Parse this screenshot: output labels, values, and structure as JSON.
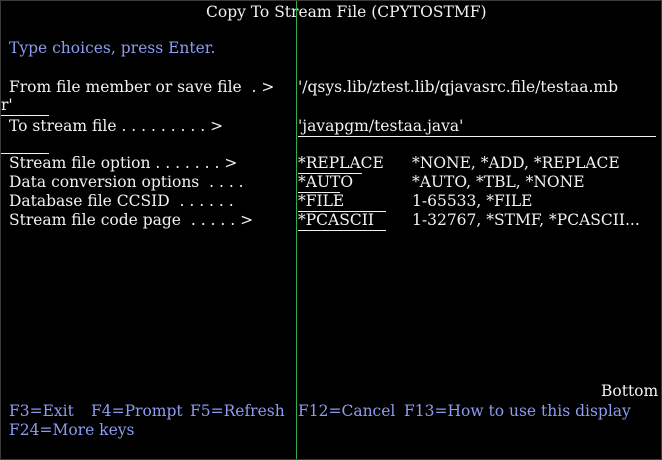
{
  "title": "Copy To Stream File (CPYTOSTMF)",
  "instruction": "Type choices, press Enter.",
  "fields": [
    {
      "label": "From file member or save file  . >",
      "value": "'/qsys.lib/ztest.lib/qjavasrc.file/testaa.mb",
      "value_wrap": "r'",
      "allowed": ""
    },
    {
      "label": "To stream file . . . . . . . . . >",
      "value": "'javapgm/testaa.java'",
      "allowed": ""
    },
    {
      "label": "Stream file option . . . . . . . >",
      "value": "*REPLACE",
      "allowed": "*NONE, *ADD, *REPLACE"
    },
    {
      "label": "Data conversion options  . . . .",
      "value": "*AUTO",
      "allowed": "*AUTO, *TBL, *NONE"
    },
    {
      "label": "Database file CCSID  . . . . . .",
      "value": "*FILE",
      "allowed": "1-65533, *FILE"
    },
    {
      "label": "Stream file code page  . . . . . >",
      "value": "*PCASCII",
      "allowed": "1-32767, *STMF, *PCASCII..."
    }
  ],
  "status": "Bottom",
  "function_keys": [
    "F3=Exit",
    "F4=Prompt",
    "F5=Refresh",
    "F12=Cancel",
    "F13=How to use this display",
    "F24=More keys"
  ],
  "colors": {
    "background": "#000000",
    "text_white": "#f2f2f2",
    "text_blue": "#8c9cf0",
    "cursor_line": "#2fae4a"
  }
}
